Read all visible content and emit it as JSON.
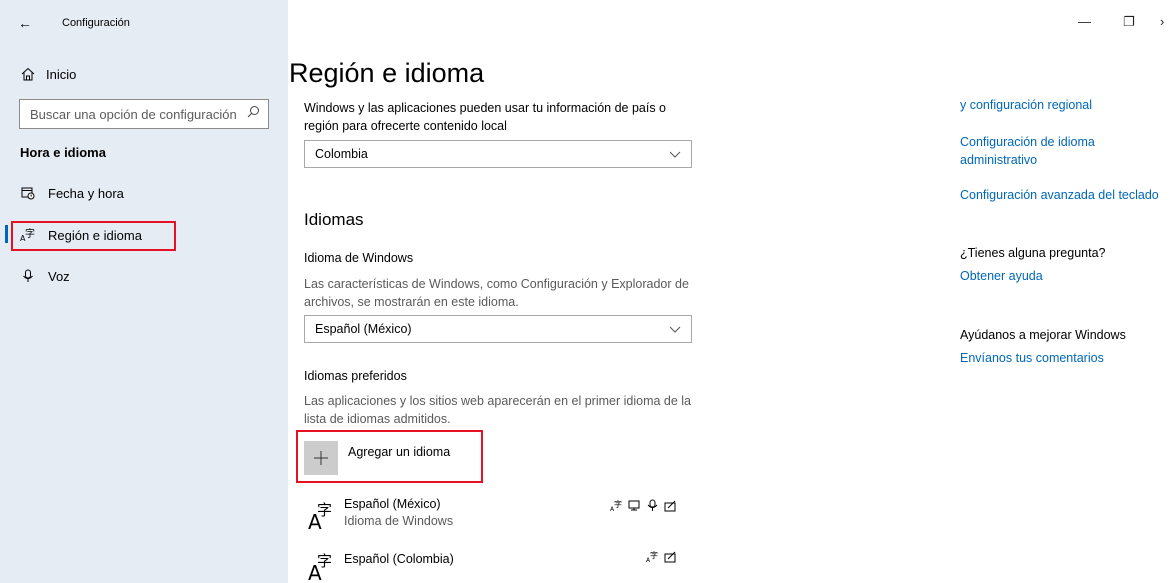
{
  "window": {
    "title": "Configuración",
    "back_icon": "back-arrow-icon",
    "controls": {
      "minimize": "—",
      "restore": "❐",
      "close": "›"
    }
  },
  "sidebar": {
    "home": {
      "label": "Inicio",
      "icon": "home-icon"
    },
    "search": {
      "placeholder": "Buscar una opción de configuración",
      "icon": "search-icon"
    },
    "section_title": "Hora e idioma",
    "items": [
      {
        "label": "Fecha y hora",
        "icon": "calendar-clock-icon",
        "active": false
      },
      {
        "label": "Región e idioma",
        "icon": "language-icon",
        "active": true
      },
      {
        "label": "Voz",
        "icon": "microphone-icon",
        "active": false
      }
    ]
  },
  "main": {
    "title": "Región e idioma",
    "region": {
      "description": "Windows y las aplicaciones pueden usar tu información de país o región para ofrecerte contenido local",
      "selected": "Colombia"
    },
    "languages": {
      "heading": "Idiomas",
      "windows_language_label": "Idioma de Windows",
      "windows_language_desc": "Las características de Windows, como Configuración y Explorador de archivos, se mostrarán en este idioma.",
      "windows_language_selected": "Español (México)",
      "preferred_label": "Idiomas preferidos",
      "preferred_desc": "Las aplicaciones y los sitios web aparecerán en el primer idioma de la lista de idiomas admitidos.",
      "add_label": "Agregar un idioma",
      "list": [
        {
          "name": "Español (México)",
          "sub": "Idioma de Windows",
          "features": [
            "display-language-icon",
            "text-to-speech-icon",
            "speech-recognition-icon",
            "handwriting-icon"
          ]
        },
        {
          "name": "Español (Colombia)",
          "sub": "",
          "features": [
            "display-language-icon",
            "handwriting-icon"
          ]
        }
      ]
    }
  },
  "related": {
    "links": [
      {
        "text": "y configuración regional"
      },
      {
        "text": "Configuración de idioma administrativo"
      },
      {
        "text": "Configuración avanzada del teclado"
      }
    ],
    "question": "¿Tienes alguna pregunta?",
    "help_link": "Obtener ayuda",
    "feedback_title": "Ayúdanos a mejorar Windows",
    "feedback_link": "Envíanos tus comentarios"
  },
  "colors": {
    "accent": "#0067b8",
    "highlight": "#e81123",
    "sidebar_bg": "#e6ecf3"
  }
}
